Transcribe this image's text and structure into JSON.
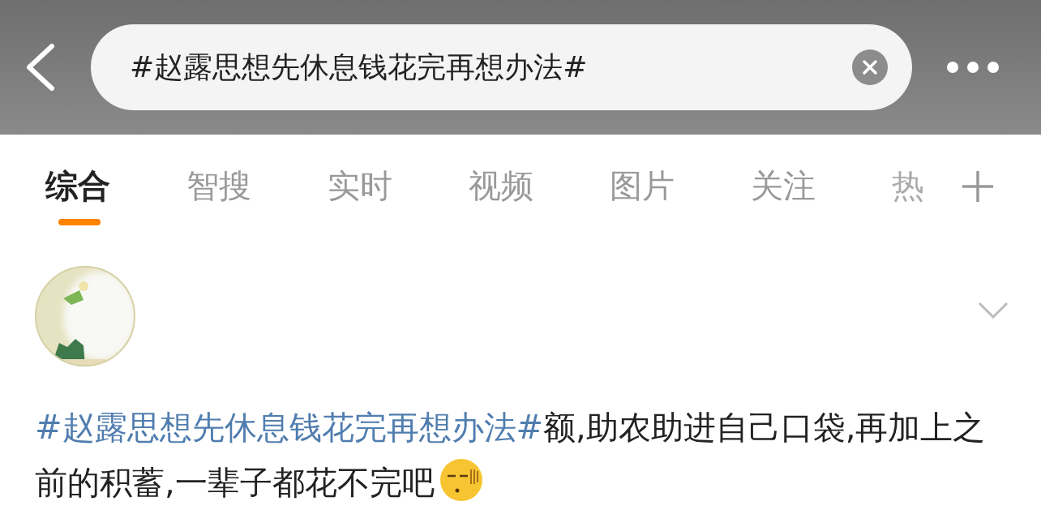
{
  "search": {
    "value": "#赵露思想先休息钱花完再想办法#"
  },
  "tabs": [
    {
      "label": "综合",
      "selected": true
    },
    {
      "label": "智搜",
      "selected": false
    },
    {
      "label": "实时",
      "selected": false
    },
    {
      "label": "视频",
      "selected": false
    },
    {
      "label": "图片",
      "selected": false
    },
    {
      "label": "关注",
      "selected": false
    },
    {
      "label": "热",
      "selected": false
    }
  ],
  "post": {
    "hashtag": "#赵露思想先休息钱花完再想办法#",
    "text": "额,助农助进自己口袋,再加上之前的积蓄,一辈子都花不完吧"
  }
}
